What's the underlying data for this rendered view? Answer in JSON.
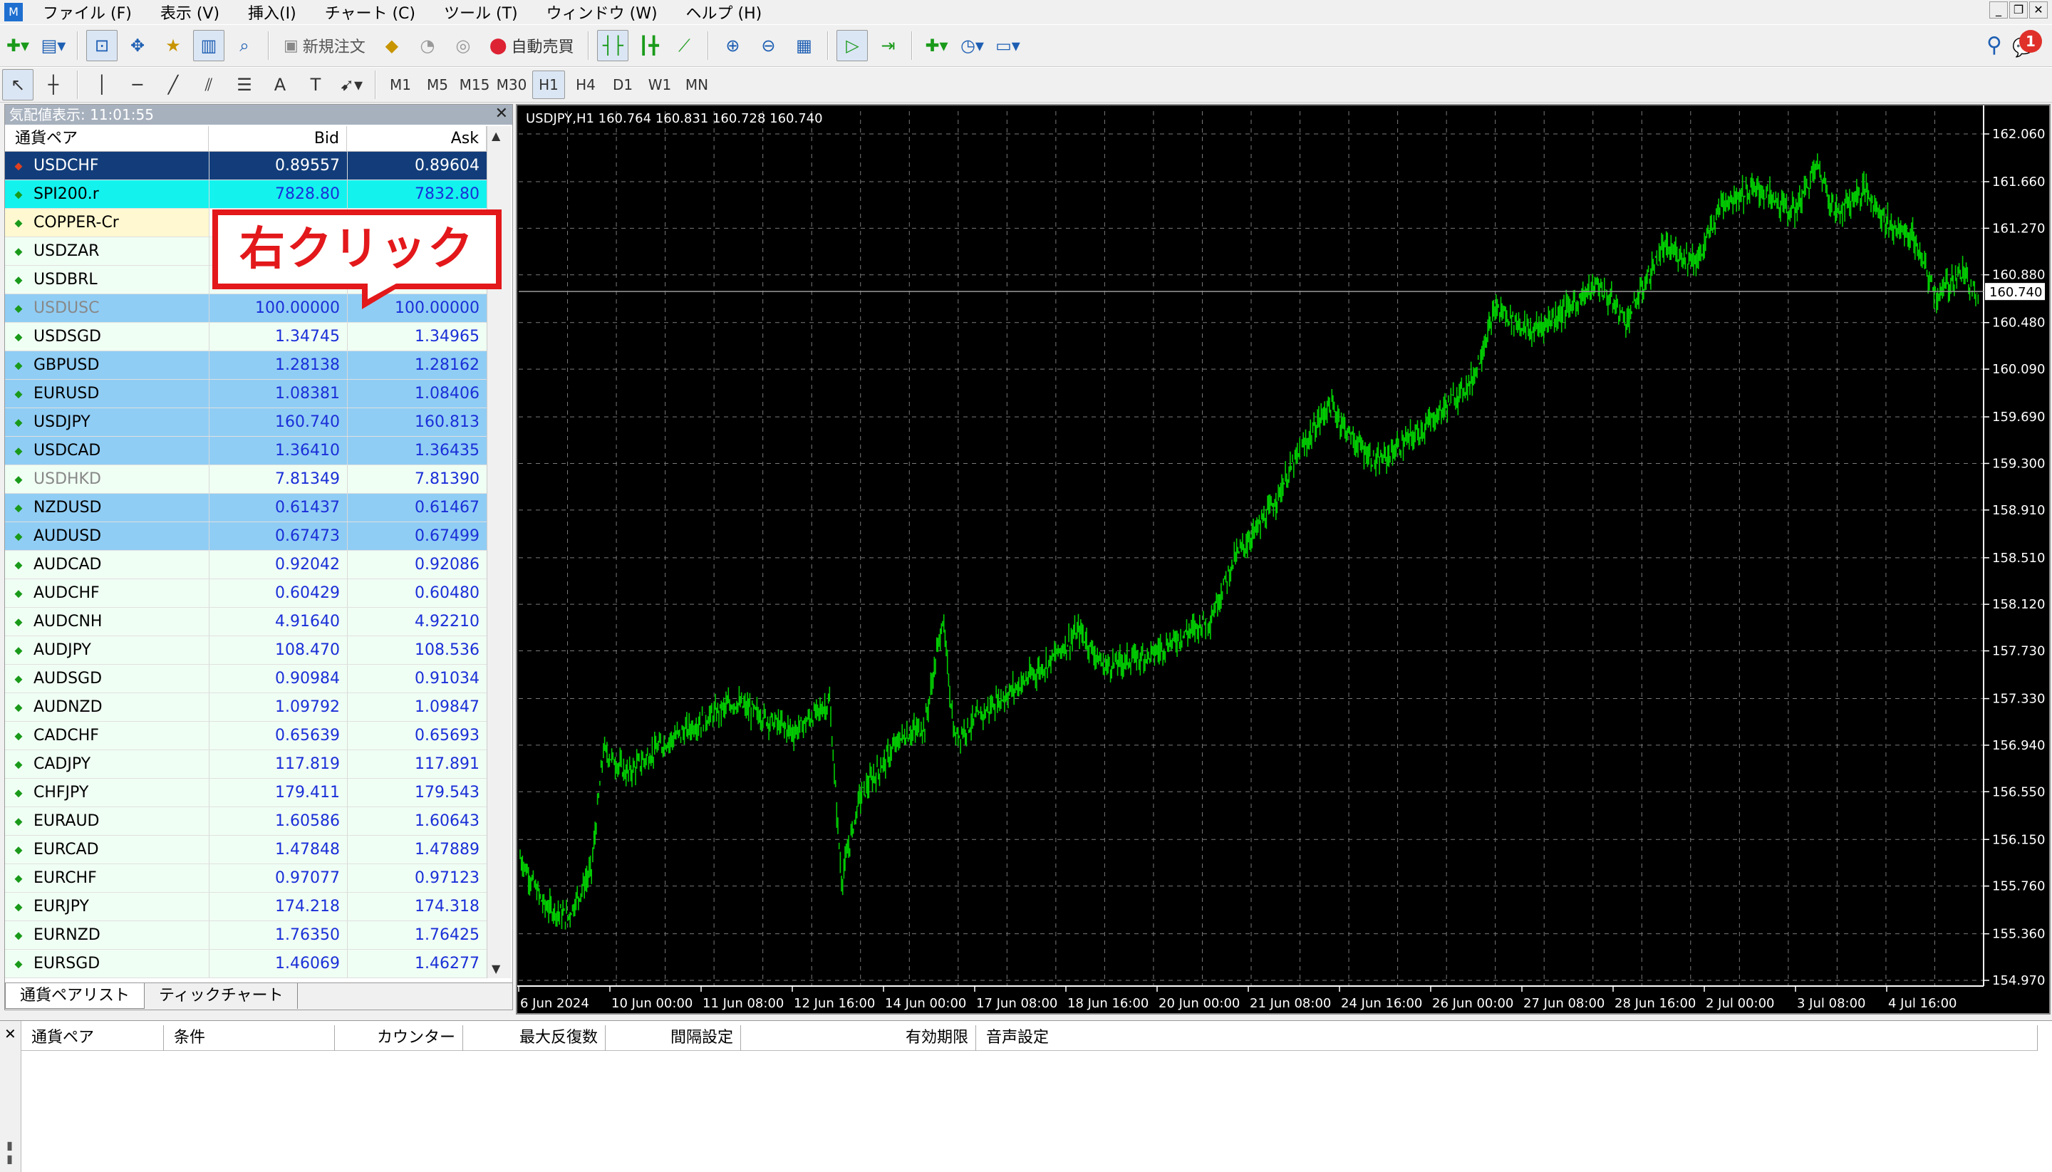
{
  "menu": [
    "ファイル (F)",
    "表示 (V)",
    "挿入(I)",
    "チャート (C)",
    "ツール (T)",
    "ウィンドウ (W)",
    "ヘルプ (H)"
  ],
  "toolbar": {
    "new_order": "新規注文",
    "auto_trading": "自動売買",
    "timeframes": [
      "M1",
      "M5",
      "M15",
      "M30",
      "H1",
      "H4",
      "D1",
      "W1",
      "MN"
    ],
    "active_timeframe": "H1",
    "notification_count": "1"
  },
  "market_watch": {
    "title": "気配値表示: 11:01:55",
    "columns": [
      "通貨ペア",
      "Bid",
      "Ask"
    ],
    "rows": [
      {
        "symbol": "USDCHF",
        "bid": "0.89557",
        "ask": "0.89604",
        "style": "sel"
      },
      {
        "symbol": "SPI200.r",
        "bid": "7828.80",
        "ask": "7832.80",
        "style": "cyan"
      },
      {
        "symbol": "COPPER-Cr",
        "bid": "",
        "ask": "",
        "style": "cream"
      },
      {
        "symbol": "USDZAR",
        "bid": "",
        "ask": "",
        "style": "mint"
      },
      {
        "symbol": "USDBRL",
        "bid": "",
        "ask": "",
        "style": "mint"
      },
      {
        "symbol": "USDUSC",
        "bid": "100.00000",
        "ask": "100.00000",
        "style": "lblue gray"
      },
      {
        "symbol": "USDSGD",
        "bid": "1.34745",
        "ask": "1.34965",
        "style": "mint"
      },
      {
        "symbol": "GBPUSD",
        "bid": "1.28138",
        "ask": "1.28162",
        "style": "lblue"
      },
      {
        "symbol": "EURUSD",
        "bid": "1.08381",
        "ask": "1.08406",
        "style": "lblue"
      },
      {
        "symbol": "USDJPY",
        "bid": "160.740",
        "ask": "160.813",
        "style": "lblue"
      },
      {
        "symbol": "USDCAD",
        "bid": "1.36410",
        "ask": "1.36435",
        "style": "lblue"
      },
      {
        "symbol": "USDHKD",
        "bid": "7.81349",
        "ask": "7.81390",
        "style": "mint gray"
      },
      {
        "symbol": "NZDUSD",
        "bid": "0.61437",
        "ask": "0.61467",
        "style": "lblue"
      },
      {
        "symbol": "AUDUSD",
        "bid": "0.67473",
        "ask": "0.67499",
        "style": "lblue"
      },
      {
        "symbol": "AUDCAD",
        "bid": "0.92042",
        "ask": "0.92086",
        "style": "mint"
      },
      {
        "symbol": "AUDCHF",
        "bid": "0.60429",
        "ask": "0.60480",
        "style": "mint"
      },
      {
        "symbol": "AUDCNH",
        "bid": "4.91640",
        "ask": "4.92210",
        "style": "mint"
      },
      {
        "symbol": "AUDJPY",
        "bid": "108.470",
        "ask": "108.536",
        "style": "mint"
      },
      {
        "symbol": "AUDSGD",
        "bid": "0.90984",
        "ask": "0.91034",
        "style": "mint"
      },
      {
        "symbol": "AUDNZD",
        "bid": "1.09792",
        "ask": "1.09847",
        "style": "mint"
      },
      {
        "symbol": "CADCHF",
        "bid": "0.65639",
        "ask": "0.65693",
        "style": "mint"
      },
      {
        "symbol": "CADJPY",
        "bid": "117.819",
        "ask": "117.891",
        "style": "mint"
      },
      {
        "symbol": "CHFJPY",
        "bid": "179.411",
        "ask": "179.543",
        "style": "mint"
      },
      {
        "symbol": "EURAUD",
        "bid": "1.60586",
        "ask": "1.60643",
        "style": "mint"
      },
      {
        "symbol": "EURCAD",
        "bid": "1.47848",
        "ask": "1.47889",
        "style": "mint"
      },
      {
        "symbol": "EURCHF",
        "bid": "0.97077",
        "ask": "0.97123",
        "style": "mint"
      },
      {
        "symbol": "EURJPY",
        "bid": "174.218",
        "ask": "174.318",
        "style": "mint"
      },
      {
        "symbol": "EURNZD",
        "bid": "1.76350",
        "ask": "1.76425",
        "style": "mint"
      },
      {
        "symbol": "EURSGD",
        "bid": "1.46069",
        "ask": "1.46277",
        "style": "mint"
      }
    ],
    "tabs": [
      "通貨ペアリスト",
      "ティックチャート"
    ]
  },
  "callout": "右クリック",
  "chart": {
    "info": "USDJPY,H1  160.764 160.831 160.728 160.740",
    "price_labels": [
      "162.060",
      "161.660",
      "161.270",
      "160.880",
      "160.480",
      "160.090",
      "159.690",
      "159.300",
      "158.910",
      "158.510",
      "158.120",
      "157.730",
      "157.330",
      "156.940",
      "156.550",
      "156.150",
      "155.760",
      "155.360",
      "154.970"
    ],
    "current_price": "160.740",
    "time_labels": [
      "6 Jun 2024",
      "10 Jun 00:00",
      "11 Jun 08:00",
      "12 Jun 16:00",
      "14 Jun 00:00",
      "17 Jun 08:00",
      "18 Jun 16:00",
      "20 Jun 00:00",
      "21 Jun 08:00",
      "24 Jun 16:00",
      "26 Jun 00:00",
      "27 Jun 08:00",
      "28 Jun 16:00",
      "2 Jul 00:00",
      "3 Jul 08:00",
      "4 Jul 16:00"
    ],
    "series_color": "#00cc00"
  },
  "alerts": {
    "columns": [
      "通貨ペア",
      "条件",
      "カウンター",
      "最大反復数",
      "間隔設定",
      "有効期限",
      "音声設定"
    ]
  }
}
